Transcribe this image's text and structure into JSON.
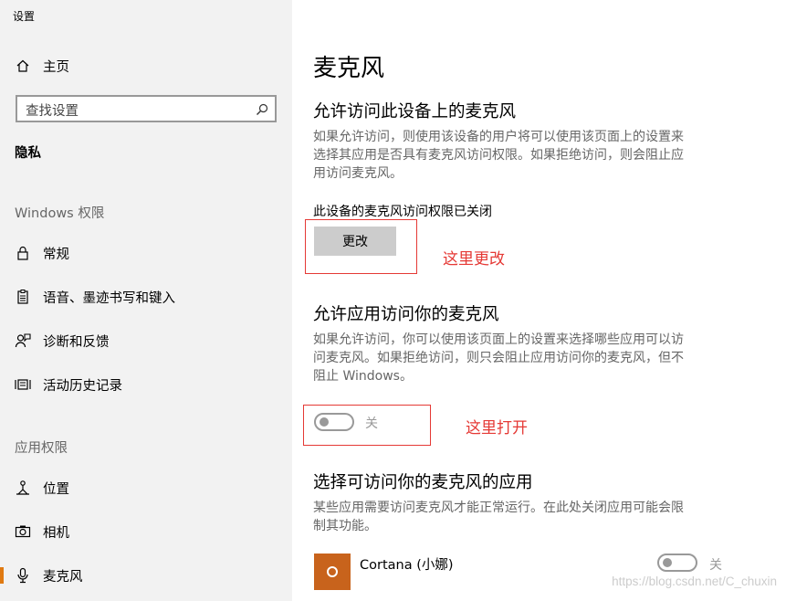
{
  "window": {
    "title": "设置"
  },
  "sidebar": {
    "home": {
      "label": "主页",
      "icon": "home-icon"
    },
    "search": {
      "placeholder": "查找设置",
      "icon": "search-icon"
    },
    "privacy_header": "隐私",
    "windows_perm_header": "Windows 权限",
    "windows_items": [
      {
        "label": "常规",
        "icon": "lock-icon"
      },
      {
        "label": "语音、墨迹书写和键入",
        "icon": "clipboard-icon"
      },
      {
        "label": "诊断和反馈",
        "icon": "feedback-person-icon"
      },
      {
        "label": "活动历史记录",
        "icon": "activity-history-icon"
      }
    ],
    "app_perm_header": "应用权限",
    "app_items": [
      {
        "label": "位置",
        "icon": "location-icon"
      },
      {
        "label": "相机",
        "icon": "camera-icon"
      },
      {
        "label": "麦克风",
        "icon": "microphone-icon",
        "selected": true
      }
    ],
    "accent_color": "#e07a12"
  },
  "main": {
    "title": "麦克风",
    "section1": {
      "heading": "允许访问此设备上的麦克风",
      "desc_lines": [
        "如果允许访问，则使用该设备的用户将可以使用该页面上的设置来",
        "选择其应用是否具有麦克风访问权限。如果拒绝访问，则会阻止应",
        "用访问麦克风。"
      ],
      "status": "此设备的麦克风访问权限已关闭",
      "button": "更改",
      "annotation": "这里更改"
    },
    "section2": {
      "heading": "允许应用访问你的麦克风",
      "desc_lines": [
        "如果允许访问，你可以使用该页面上的设置来选择哪些应用可以访",
        "问麦克风。如果拒绝访问，则只会阻止应用访问你的麦克风，但不",
        "阻止 Windows。"
      ],
      "toggle_label": "关",
      "toggle_on": false,
      "annotation": "这里打开"
    },
    "section3": {
      "heading": "选择可访问你的麦克风的应用",
      "desc_lines": [
        "某些应用需要访问麦克风才能正常运行。在此处关闭应用可能会限",
        "制其功能。"
      ],
      "apps": [
        {
          "name": "Cortana (小娜)",
          "toggle_label": "关",
          "toggle_on": false,
          "icon": "cortana-icon",
          "icon_color": "#c8631c"
        }
      ]
    },
    "annotation_color": "#e53935"
  },
  "watermark": "https://blog.csdn.net/C_chuxin"
}
